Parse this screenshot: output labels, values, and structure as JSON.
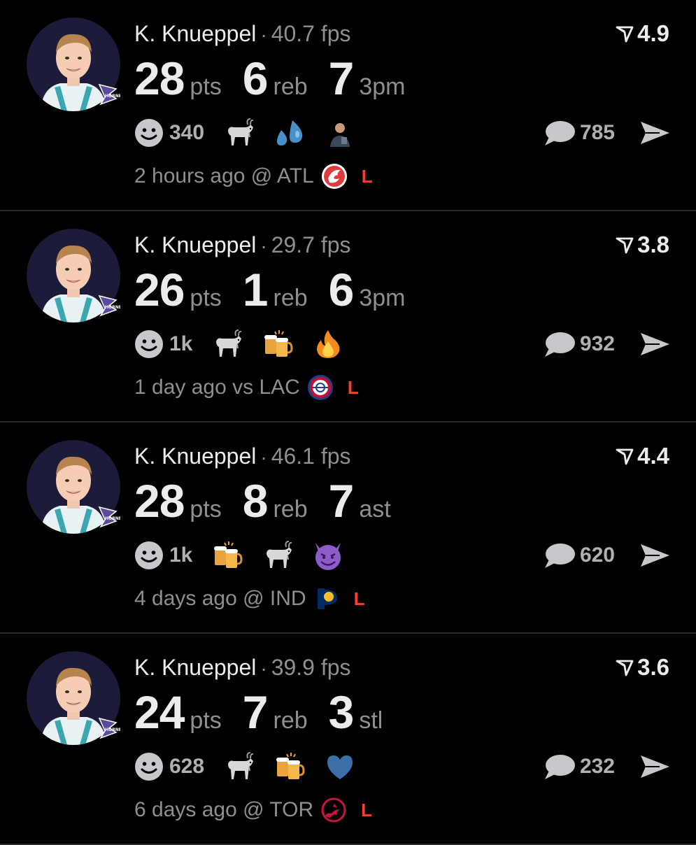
{
  "posts": [
    {
      "player": "K. Knueppel",
      "fps": "40.7 fps",
      "score": "4.9",
      "stats": [
        {
          "value": "28",
          "label": "pts"
        },
        {
          "value": "6",
          "label": "reb"
        },
        {
          "value": "7",
          "label": "3pm"
        }
      ],
      "smiley_count": "340",
      "emojis": [
        "goat",
        "sweat-droplets",
        "person-photo"
      ],
      "comment_count": "785",
      "time_location": "2 hours ago @ ATL",
      "team_logo": "hawks-logo",
      "result": "L"
    },
    {
      "player": "K. Knueppel",
      "fps": "29.7 fps",
      "score": "3.8",
      "stats": [
        {
          "value": "26",
          "label": "pts"
        },
        {
          "value": "1",
          "label": "reb"
        },
        {
          "value": "6",
          "label": "3pm"
        }
      ],
      "smiley_count": "1k",
      "emojis": [
        "goat",
        "beer-mugs",
        "fire"
      ],
      "comment_count": "932",
      "time_location": "1 day ago vs LAC",
      "team_logo": "clippers-logo",
      "result": "L"
    },
    {
      "player": "K. Knueppel",
      "fps": "46.1 fps",
      "score": "4.4",
      "stats": [
        {
          "value": "28",
          "label": "pts"
        },
        {
          "value": "8",
          "label": "reb"
        },
        {
          "value": "7",
          "label": "ast"
        }
      ],
      "smiley_count": "1k",
      "emojis": [
        "beer-mugs",
        "goat",
        "smiling-devil"
      ],
      "comment_count": "620",
      "time_location": "4 days ago @ IND",
      "team_logo": "pacers-logo",
      "result": "L"
    },
    {
      "player": "K. Knueppel",
      "fps": "39.9 fps",
      "score": "3.6",
      "stats": [
        {
          "value": "24",
          "label": "pts"
        },
        {
          "value": "7",
          "label": "reb"
        },
        {
          "value": "3",
          "label": "stl"
        }
      ],
      "smiley_count": "628",
      "emojis": [
        "goat",
        "beer-mugs",
        "blue-heart"
      ],
      "comment_count": "232",
      "time_location": "6 days ago @ TOR",
      "team_logo": "raptors-logo",
      "result": "L"
    }
  ],
  "colors": {
    "background": "#000000",
    "primary_text": "#ececec",
    "secondary_text": "#8e8e93",
    "loss": "#ff3b30"
  }
}
